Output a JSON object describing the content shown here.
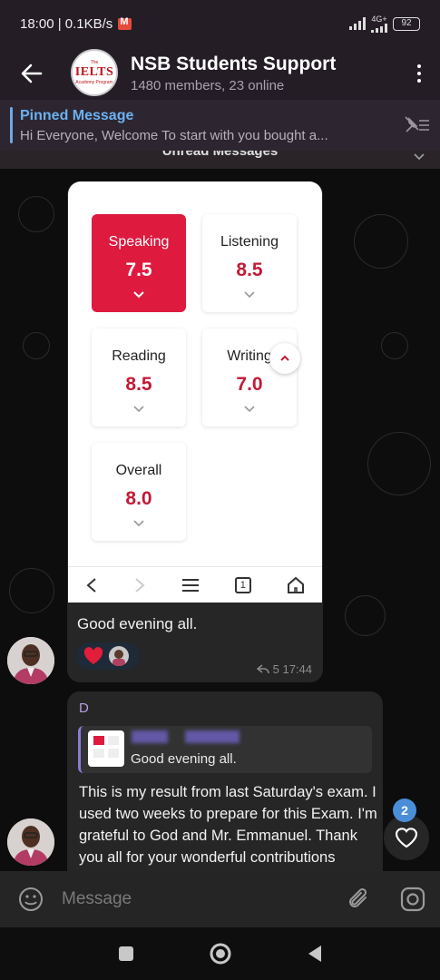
{
  "status_bar": {
    "time_speed": "18:00 | 0.1KB/s",
    "mail_icon": "gmail-icon",
    "network": "4G+",
    "battery": "92"
  },
  "header": {
    "back_icon": "arrow-left-icon",
    "group_avatar": {
      "logo_text": "IELTS",
      "top_text": "The",
      "sub_text": "Academy Program"
    },
    "title": "NSB Students Support",
    "subtitle": "1480 members, 23 online",
    "menu_icon": "more-vertical-icon"
  },
  "pinned": {
    "title": "Pinned Message",
    "preview": "Hi Everyone,   Welcome   To start with you bought a...",
    "icon": "unpin-list-icon"
  },
  "unread_label": "Unread Messages",
  "messages": [
    {
      "score_cards": [
        {
          "label": "Speaking",
          "value": "7.5",
          "active": true
        },
        {
          "label": "Listening",
          "value": "8.5",
          "active": false
        },
        {
          "label": "Reading",
          "value": "8.5",
          "active": false
        },
        {
          "label": "Writing",
          "value": "7.0",
          "active": false
        },
        {
          "label": "Overall",
          "value": "8.0",
          "active": false
        }
      ],
      "browser_nav": {
        "tab_count": "1"
      },
      "caption": "Good evening all.",
      "reaction": "heart",
      "meta": "5 17:44"
    },
    {
      "sender_initial": "D",
      "reply_preview": "Good evening all.",
      "text": "This is my result from last Saturday's exam. I used two weeks to prepare for this Exam. I'm grateful to God and Mr. Emmanuel. Thank you all for your wonderful contributions"
    }
  ],
  "fab": {
    "badge_count": "2",
    "icon": "heart-outline-icon"
  },
  "input": {
    "placeholder": "Message",
    "emoji_icon": "emoji-icon",
    "attach_icon": "paperclip-icon",
    "camera_icon": "instagram-camera-icon"
  },
  "colors": {
    "accent_red": "#de1a3f",
    "link_blue": "#6cb1f0",
    "header_bg": "#241d26"
  }
}
